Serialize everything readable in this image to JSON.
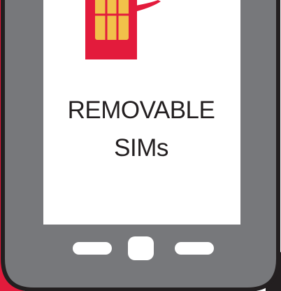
{
  "illustration": {
    "title_line_1": "REMOVABLE",
    "title_line_2": "SIMs",
    "icons": [
      "sim-card-icon",
      "phone-icon",
      "soft-key-icon",
      "home-button-icon"
    ],
    "colors": {
      "accent_red": "#e31b3c",
      "phone_body": "#77787b",
      "screen": "#ffffff",
      "sim_chip": "#f1c14a",
      "outline": "#231f20",
      "text": "#231f20"
    }
  }
}
